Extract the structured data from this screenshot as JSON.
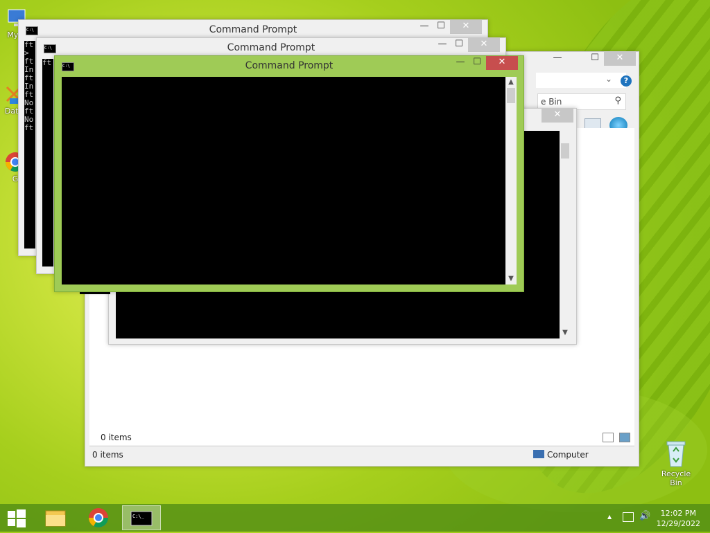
{
  "desktop": {
    "icons": [
      {
        "label": "My C",
        "icon": "computer-icon"
      },
      {
        "label": "Data",
        "icon": "data-icon"
      },
      {
        "label": "G",
        "icon": "chrome-icon"
      },
      {
        "label": "Recycle Bin",
        "icon": "recycle-bin-icon"
      }
    ]
  },
  "windows": {
    "cmd_back": {
      "title": "Command Prompt",
      "lines": [
        "ft",
        ">",
        "ft",
        "In",
        "ft",
        "In",
        "ft",
        "No",
        "ft",
        "No",
        "ft"
      ]
    },
    "cmd_mid": {
      "title": "Command Prompt",
      "lines": [
        "ft"
      ]
    },
    "cmd_front": {
      "title": "Command Prompt"
    },
    "explorer": {
      "search_text": "e Bin",
      "items_count_inner": "0 items",
      "status_left": "0 items",
      "status_right": "Computer"
    }
  },
  "window_buttons": {
    "minimize": "—",
    "maximize": "☐",
    "close": "✕"
  },
  "scroll": {
    "up": "▲",
    "down": "▼",
    "dropdown": "⌄"
  },
  "taskbar": {
    "items": [
      "start-button",
      "file-explorer",
      "chrome",
      "command-prompt"
    ],
    "time": "12:02 PM",
    "date": "12/29/2022",
    "tray_arrow": "▲"
  }
}
